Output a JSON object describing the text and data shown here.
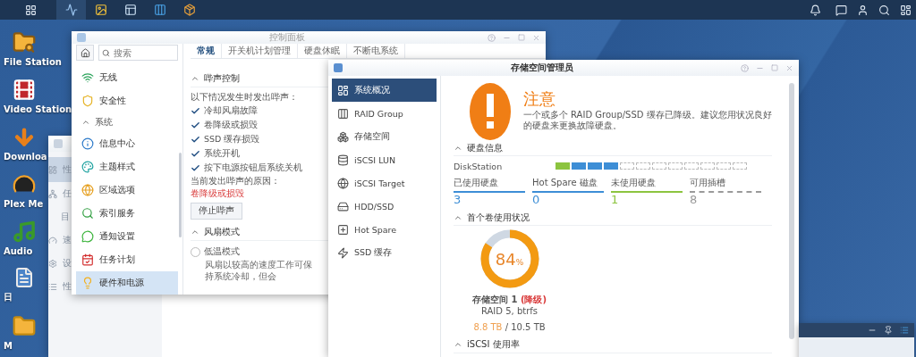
{
  "desktop_icons": [
    {
      "label": "File Station"
    },
    {
      "label": "Video Station"
    },
    {
      "label": "Downloa"
    },
    {
      "label": "Plex Me"
    },
    {
      "label": "Audio"
    },
    {
      "label": "日"
    },
    {
      "label": "M"
    }
  ],
  "resource_monitor": {
    "sidebar": [
      {
        "label": "性",
        "selected": true
      },
      {
        "label": "任",
        "selected": false
      },
      {
        "label": "目",
        "selected": false
      },
      {
        "label": "速",
        "selected": false
      },
      {
        "label": "设",
        "selected": false
      },
      {
        "label": "性",
        "selected": false
      }
    ]
  },
  "control_panel": {
    "title": "控制面板",
    "search": {
      "placeholder": "搜索"
    },
    "sidebar": [
      {
        "kind": "item",
        "label": "无线",
        "selected": false
      },
      {
        "kind": "item",
        "label": "安全性",
        "selected": false
      },
      {
        "kind": "section",
        "label": "系统",
        "expanded": true
      },
      {
        "kind": "item",
        "label": "信息中心",
        "selected": false
      },
      {
        "kind": "item",
        "label": "主题样式",
        "selected": false
      },
      {
        "kind": "item",
        "label": "区域选项",
        "selected": false
      },
      {
        "kind": "item",
        "label": "索引服务",
        "selected": false
      },
      {
        "kind": "item",
        "label": "通知设置",
        "selected": false
      },
      {
        "kind": "item",
        "label": "任务计划",
        "selected": false
      },
      {
        "kind": "item",
        "label": "硬件和电源",
        "selected": true
      }
    ],
    "tabs": [
      {
        "label": "常规",
        "selected": true
      },
      {
        "label": "开关机计划管理",
        "selected": false
      },
      {
        "label": "硬盘休眠",
        "selected": false
      },
      {
        "label": "不断电系统",
        "selected": false
      }
    ],
    "beep": {
      "title": "哔声控制",
      "expanded": true,
      "intro": "以下情况发生时发出哔声：",
      "options": [
        {
          "label": "冷却风扇故障",
          "checked": true
        },
        {
          "label": "卷降级或损毁",
          "checked": true
        },
        {
          "label": "SSD 缓存损毁",
          "checked": true
        },
        {
          "label": "系统开机",
          "checked": true
        },
        {
          "label": "按下电源按钮后系统关机",
          "checked": true
        }
      ],
      "reason_label": "当前发出哔声的原因：",
      "reason": "卷降级或损毁",
      "button": "停止哔声"
    },
    "fan": {
      "title": "风扇模式",
      "expanded": true,
      "options": [
        {
          "label": "低温模式",
          "selected": false
        }
      ],
      "description": "风扇以较高的速度工作可保持系统冷却，但会"
    }
  },
  "storage_manager": {
    "title": "存储空间管理员",
    "sidebar": [
      {
        "label": "系统概况",
        "selected": true
      },
      {
        "label": "RAID Group",
        "selected": false
      },
      {
        "label": "存储空间",
        "selected": false
      },
      {
        "label": "iSCSI LUN",
        "selected": false
      },
      {
        "label": "iSCSI Target",
        "selected": false
      },
      {
        "label": "HDD/SSD",
        "selected": false
      },
      {
        "label": "Hot Spare",
        "selected": false
      },
      {
        "label": "SSD 缓存",
        "selected": false
      }
    ],
    "alert": {
      "title": "注意",
      "message": "一个或多个 RAID Group/SSD 缓存已降级。建议您用状况良好的硬盘来更换故障硬盘。"
    },
    "disk_info": {
      "title": "硬盘信息",
      "expanded": true,
      "device": "DiskStation",
      "slots": [
        {
          "kind": "unused"
        },
        {
          "kind": "used"
        },
        {
          "kind": "used"
        },
        {
          "kind": "used"
        },
        {
          "kind": "empty"
        },
        {
          "kind": "empty"
        },
        {
          "kind": "empty"
        },
        {
          "kind": "empty"
        },
        {
          "kind": "empty"
        },
        {
          "kind": "empty"
        },
        {
          "kind": "empty"
        },
        {
          "kind": "empty"
        }
      ],
      "stats": [
        {
          "label": "已使用硬盘",
          "value": "3",
          "color": "#3d8ed6",
          "dashed": false
        },
        {
          "label": "Hot Spare 磁盘",
          "value": "0",
          "color": "#3d8ed6",
          "dashed": false
        },
        {
          "label": "未使用硬盘",
          "value": "1",
          "color": "#8cc43f",
          "dashed": false
        },
        {
          "label": "可用插槽",
          "value": "8",
          "color": "#9a9a9a",
          "dashed": true
        }
      ]
    },
    "volume": {
      "title": "首个卷使用状况",
      "expanded": true,
      "level": 0.84,
      "percent": "84",
      "percent_sign": "%",
      "name": "存储空间 1",
      "status": "(降级)",
      "raid": "RAID 5, btrfs",
      "used": "8.8 TB",
      "total": "/ 10.5 TB"
    },
    "iscsi": {
      "title": "iSCSI 使用率",
      "expanded": true
    }
  }
}
